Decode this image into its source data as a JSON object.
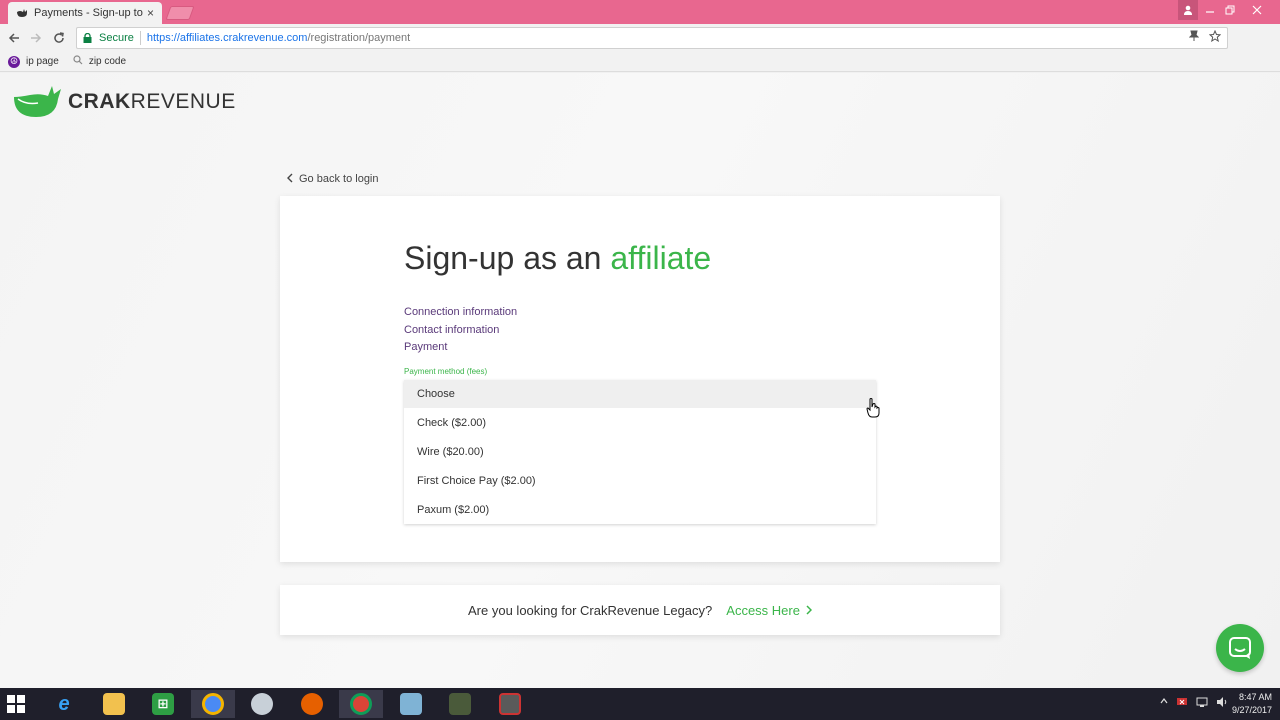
{
  "browser": {
    "tab_title": "Payments - Sign-up to C",
    "tab_close": "×",
    "secure_label": "Secure",
    "url_host": "https://affiliates.crakrevenue.com",
    "url_path": "/registration/payment",
    "bookmarks": [
      {
        "label": "ip page",
        "icon": "peace-icon"
      },
      {
        "label": "zip code",
        "icon": "search-icon"
      }
    ]
  },
  "logo": {
    "part1": "CRAK",
    "part2": "REVENUE",
    "color": "#3bb54a"
  },
  "back_link": "Go back to login",
  "card": {
    "headline_prefix": "Sign-up as an ",
    "headline_accent": "affiliate",
    "steps": [
      "Connection information",
      "Contact information",
      "Payment"
    ],
    "field_label": "Payment method (fees)",
    "options": [
      {
        "label": "Choose",
        "selected": true
      },
      {
        "label": "Check ($2.00)",
        "selected": false
      },
      {
        "label": "Wire ($20.00)",
        "selected": false
      },
      {
        "label": "First Choice Pay ($2.00)",
        "selected": false
      },
      {
        "label": "Paxum ($2.00)",
        "selected": false
      }
    ]
  },
  "legacy": {
    "question": "Are you looking for CrakRevenue Legacy?",
    "link": "Access Here"
  },
  "taskbar": {
    "time": "8:47 AM",
    "date": "9/27/2017"
  },
  "colors": {
    "accent": "#3bb54a",
    "titlebar": "#e8678f",
    "step_link": "#5a3a7a"
  }
}
